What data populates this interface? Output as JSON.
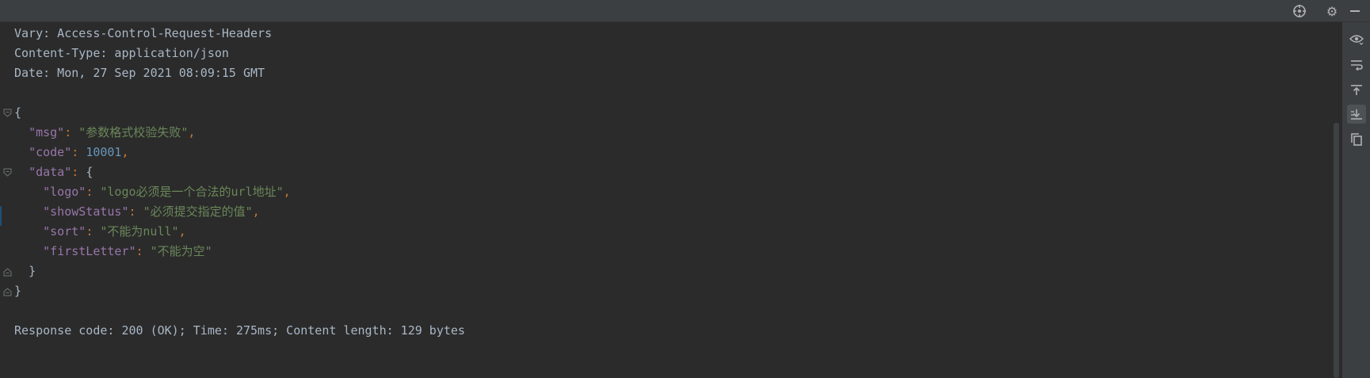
{
  "toolbar": {
    "target_icon": "crosshair-icon",
    "settings_icon": "gear-icon",
    "minimize_icon": "minimize-icon"
  },
  "headers": [
    "Vary: Access-Control-Request-Headers",
    "Content-Type: application/json",
    "Date: Mon, 27 Sep 2021 08:09:15 GMT"
  ],
  "json_body": {
    "open_brace": "{",
    "close_brace": "}",
    "msg_key": "\"msg\"",
    "msg_value": "\"参数格式校验失败\"",
    "code_key": "\"code\"",
    "code_value": "10001",
    "data_key": "\"data\"",
    "logo_key": "\"logo\"",
    "logo_value": "\"logo必须是一个合法的url地址\"",
    "showStatus_key": "\"showStatus\"",
    "showStatus_value": "\"必须提交指定的值\"",
    "sort_key": "\"sort\"",
    "sort_value": "\"不能为null\"",
    "firstLetter_key": "\"firstLetter\"",
    "firstLetter_value": "\"不能为空\"",
    "colon": ": ",
    "comma": ","
  },
  "footer": "Response code: 200 (OK); Time: 275ms; Content length: 129 bytes",
  "sidebar": {
    "buttons": [
      "eye-icon",
      "soft-wrap-icon",
      "scroll-to-top-icon",
      "scroll-to-end-icon",
      "copy-icon"
    ]
  },
  "colors": {
    "background": "#2b2b2b",
    "text": "#a9b7c6",
    "key": "#9876aa",
    "string": "#6a8759",
    "number": "#6897bb",
    "punctuation": "#cc7832"
  }
}
